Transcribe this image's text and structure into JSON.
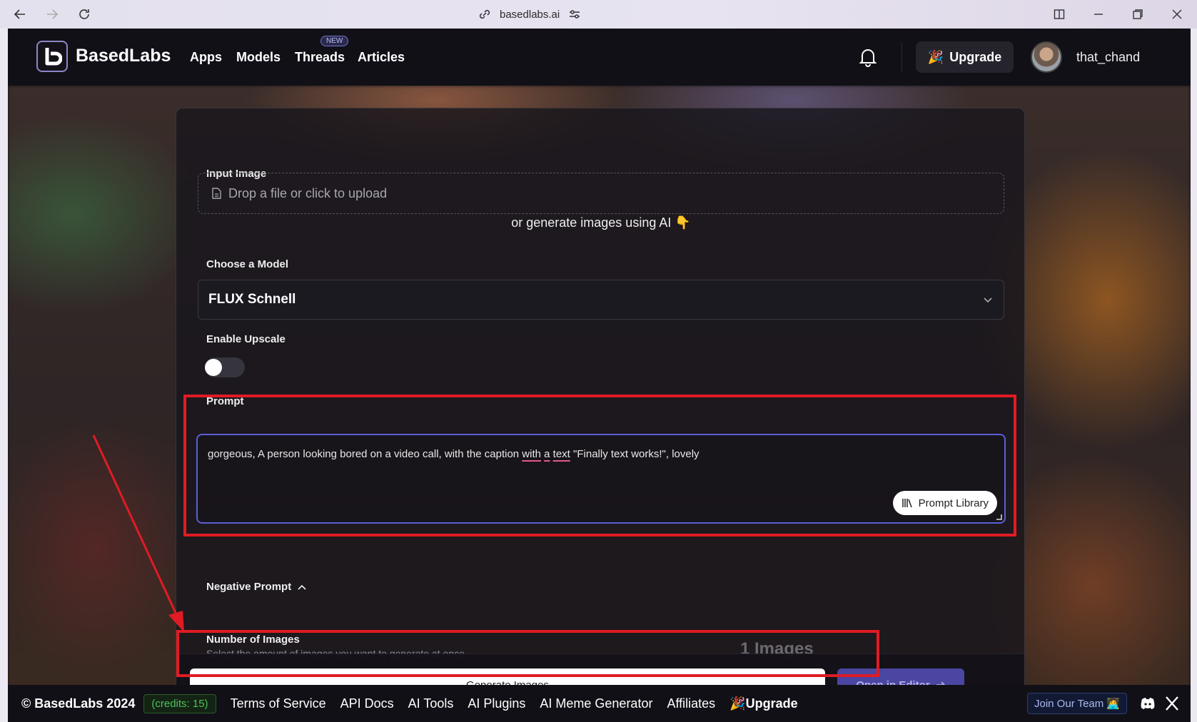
{
  "browser": {
    "url": "basedlabs.ai"
  },
  "nav": {
    "brand": "BasedLabs",
    "links": [
      "Apps",
      "Models",
      "Threads",
      "Articles"
    ],
    "new_badge": "NEW",
    "upgrade": "Upgrade",
    "username": "that_chand"
  },
  "form": {
    "input_image_label": "Input Image",
    "upload_placeholder": "Drop a file or click to upload",
    "or_generate": "or generate images using AI 👇",
    "model_label": "Choose a Model",
    "model_value": "FLUX Schnell",
    "upscale_label": "Enable Upscale",
    "upscale_enabled": false,
    "prompt_label": "Prompt",
    "prompt_part1": "gorgeous, A person looking bored on a video call, with the caption ",
    "prompt_ul1": "with",
    "prompt_ul2": "a",
    "prompt_ul3": "text",
    "prompt_part2": " \"Finally text works!\", lovely",
    "prompt_library": "Prompt Library",
    "negative_prompt": "Negative Prompt",
    "num_images_label": "Number of Images",
    "num_images_sub": "Select the amount of images you want to generate at once",
    "num_images_value": "1 Images",
    "generate": "Generate Images",
    "open_editor": "Open in Editor"
  },
  "footer": {
    "copyright": "© BasedLabs 2024",
    "credits": "(credits: 15)",
    "links": [
      "Terms of Service",
      "API Docs",
      "AI Tools",
      "AI Plugins",
      "AI Meme Generator",
      "Affiliates"
    ],
    "upgrade": "Upgrade",
    "join": "Join Our Team 🧑‍💻"
  },
  "colors": {
    "accent": "#5b5fd6",
    "annotation_red": "#e01b24",
    "credits_green": "#4ec25a"
  },
  "icons": [
    "back-arrow-icon",
    "forward-arrow-icon",
    "reload-icon",
    "link-icon",
    "site-settings-icon",
    "split-view-icon",
    "minimize-icon",
    "restore-icon",
    "close-icon",
    "bell-icon",
    "party-popper-icon",
    "file-icon",
    "chevron-down-icon",
    "library-icon",
    "chevron-up-icon",
    "arrow-right-icon",
    "discord-icon",
    "x-logo-icon"
  ]
}
